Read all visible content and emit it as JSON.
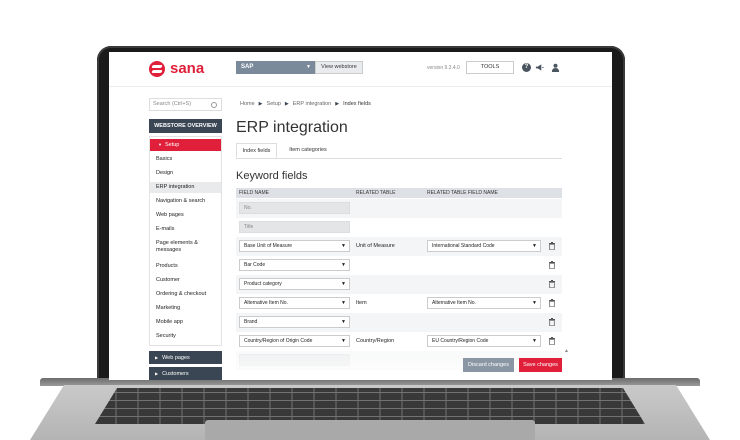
{
  "header": {
    "logo_text": "sana",
    "webstore_select": "SAP",
    "view_webstore": "View webstore",
    "version": "version 9.3.4.0",
    "tools": "TOOLS",
    "help_glyph": "?"
  },
  "sidebar": {
    "search_placeholder": "Search (Ctrl+S)",
    "webstore_overview": "WEBSTORE OVERVIEW",
    "setup_label": "Setup",
    "items": [
      {
        "label": "Basics"
      },
      {
        "label": "Design"
      },
      {
        "label": "ERP integration"
      },
      {
        "label": "Navigation & search"
      },
      {
        "label": "Web pages"
      },
      {
        "label": "E-mails"
      },
      {
        "label": "Page elements & messages"
      },
      {
        "label": "Products"
      },
      {
        "label": "Customer"
      },
      {
        "label": "Ordering & checkout"
      },
      {
        "label": "Marketing"
      },
      {
        "label": "Mobile app"
      },
      {
        "label": "Security"
      }
    ],
    "nav_sections": [
      {
        "label": "Web pages"
      },
      {
        "label": "Customers"
      }
    ]
  },
  "breadcrumb": {
    "items": [
      "Home",
      "Setup",
      "ERP integration",
      "Index fields"
    ]
  },
  "page": {
    "title": "ERP integration",
    "tabs": [
      {
        "label": "Index fields"
      },
      {
        "label": "Item categories"
      }
    ],
    "section_title": "Keyword fields"
  },
  "table": {
    "headers": [
      "FIELD NAME",
      "RELATED TABLE",
      "RELATED TABLE FIELD NAME"
    ],
    "rows": [
      {
        "field": "No.",
        "table": "",
        "related": ""
      },
      {
        "field": "Title",
        "table": "",
        "related": ""
      },
      {
        "field": "Base Unit of Measure",
        "table": "Unit of Measure",
        "related": "International Standard Code"
      },
      {
        "field": "Bar Code",
        "table": "",
        "related": ""
      },
      {
        "field": "Product category",
        "table": "",
        "related": ""
      },
      {
        "field": "Alternative Item No.",
        "table": "Item",
        "related": "Alternative Item No."
      },
      {
        "field": "Brand",
        "table": "",
        "related": ""
      },
      {
        "field": "Country/Region of Origin Code",
        "table": "Country/Region",
        "related": "EU Country/Region Code"
      }
    ]
  },
  "actions": {
    "discard": "Discard changes",
    "save": "Save changes"
  },
  "colors": {
    "accent": "#e0203a",
    "nav_dark": "#3a4653"
  }
}
